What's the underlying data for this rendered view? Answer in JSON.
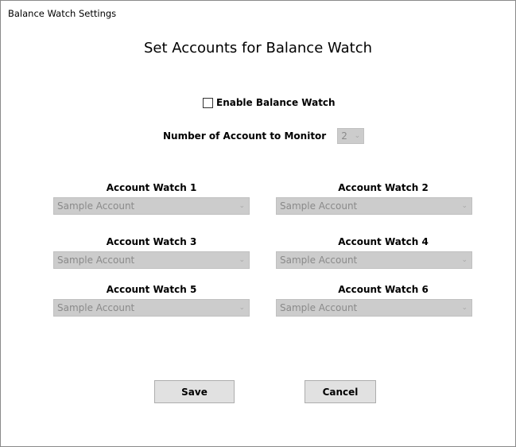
{
  "window": {
    "title": "Balance Watch Settings"
  },
  "heading": "Set Accounts for Balance Watch",
  "enable": {
    "label": "Enable Balance Watch",
    "checked": false
  },
  "count": {
    "label": "Number of Account to Monitor",
    "value": "2"
  },
  "accounts": [
    {
      "label": "Account Watch 1",
      "value": "Sample Account"
    },
    {
      "label": "Account Watch 2",
      "value": "Sample Account"
    },
    {
      "label": "Account Watch 3",
      "value": "Sample Account"
    },
    {
      "label": "Account Watch 4",
      "value": "Sample Account"
    },
    {
      "label": "Account Watch 5",
      "value": "Sample Account"
    },
    {
      "label": "Account Watch 6",
      "value": "Sample Account"
    }
  ],
  "buttons": {
    "save": "Save",
    "cancel": "Cancel"
  },
  "icons": {
    "dropdown": "chevron-down-icon",
    "checkbox": "checkbox-unchecked-icon"
  }
}
